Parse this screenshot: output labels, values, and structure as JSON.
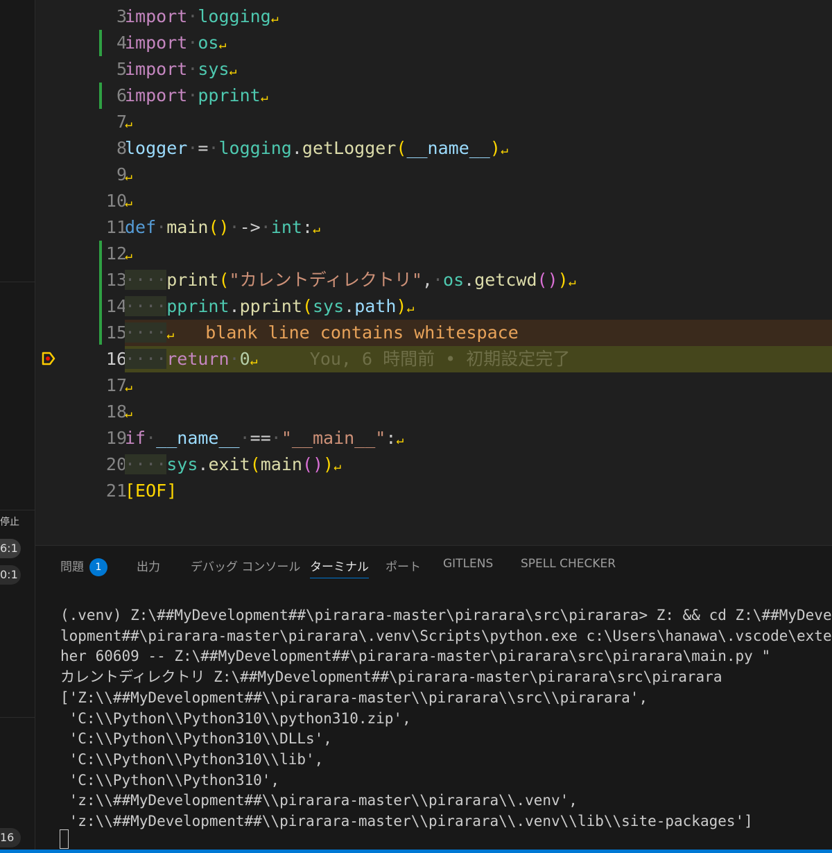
{
  "left_strip": {
    "stop_label": "停止",
    "pill1": "6:1",
    "pill2": "0:1",
    "bottom_label": "16"
  },
  "editor": {
    "line_numbers": [
      "3",
      "4",
      "5",
      "6",
      "7",
      "8",
      "9",
      "10",
      "11",
      "12",
      "13",
      "14",
      "15",
      "16",
      "17",
      "18",
      "19",
      "20",
      "21"
    ],
    "current_line": "16",
    "code": {
      "l3": {
        "kw": "import",
        "mod": "logging"
      },
      "l4": {
        "kw": "import",
        "mod": "os"
      },
      "l5": {
        "kw": "import",
        "mod": "sys"
      },
      "l6": {
        "kw": "import",
        "mod": "pprint"
      },
      "l8": {
        "var": "logger",
        "op": "=",
        "mod": "logging",
        "fn": "getLogger",
        "arg": "__name__"
      },
      "l11": {
        "kw": "def",
        "fn": "main",
        "arrow": "->",
        "type": "int"
      },
      "l13": {
        "fn": "print",
        "str": "\"カレントディレクトリ\"",
        "mod": "os",
        "fn2": "getcwd"
      },
      "l14": {
        "mod": "pprint",
        "fn": "pprint",
        "mod2": "sys",
        "attr": "path"
      },
      "l15": {
        "warning": "blank line contains whitespace"
      },
      "l16": {
        "kw": "return",
        "num": "0",
        "blame": "You, 6 時間前 • 初期設定完了"
      },
      "l19": {
        "kw": "if",
        "var": "__name__",
        "op": "==",
        "str": "\"__main__\""
      },
      "l20": {
        "mod": "sys",
        "fn": "exit",
        "fn2": "main"
      },
      "l21": {
        "eof": "[EOF]"
      }
    }
  },
  "panel": {
    "tabs": [
      {
        "label": "問題",
        "badge": "1"
      },
      {
        "label": "出力"
      },
      {
        "label": "デバッグ コンソール"
      },
      {
        "label": "ターミナル",
        "active": true
      },
      {
        "label": "ポート"
      },
      {
        "label": "GITLENS"
      },
      {
        "label": "SPELL CHECKER"
      }
    ],
    "terminal_lines": [
      "(.venv) Z:\\##MyDevelopment##\\pirarara-master\\pirarara\\src\\pirarara> Z: && cd Z:\\##MyDevelo",
      "lopment##\\pirarara-master\\pirarara\\.venv\\Scripts\\python.exe c:\\Users\\hanawa\\.vscode\\extens",
      "her 60609 -- Z:\\##MyDevelopment##\\pirarara-master\\pirarara\\src\\pirarara\\main.py \"",
      "カレントディレクトリ Z:\\##MyDevelopment##\\pirarara-master\\pirarara\\src\\pirarara",
      "['Z:\\\\##MyDevelopment##\\\\pirarara-master\\\\pirarara\\\\src\\\\pirarara',",
      " 'C:\\\\Python\\\\Python310\\\\python310.zip',",
      " 'C:\\\\Python\\\\Python310\\\\DLLs',",
      " 'C:\\\\Python\\\\Python310\\\\lib',",
      " 'C:\\\\Python\\\\Python310',",
      " 'z:\\\\##MyDevelopment##\\\\pirarara-master\\\\pirarara\\\\.venv',",
      " 'z:\\\\##MyDevelopment##\\\\pirarara-master\\\\pirarara\\\\.venv\\\\lib\\\\site-packages']"
    ]
  },
  "colors": {
    "accent": "#0078d4",
    "gutter_modified": "#2ea043",
    "warning_line": "#3a2a1c",
    "current_line": "#45461c"
  }
}
